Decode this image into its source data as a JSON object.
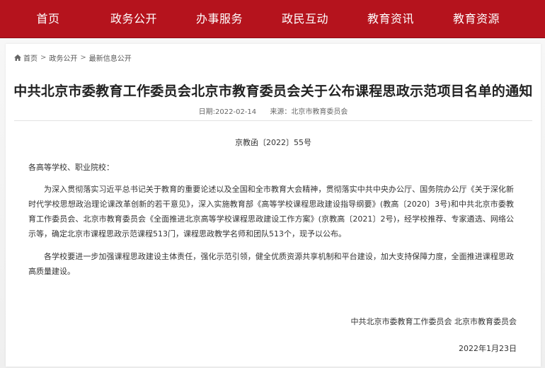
{
  "nav": {
    "items": [
      "首页",
      "政务公开",
      "办事服务",
      "政民互动",
      "教育资讯",
      "教育资源"
    ]
  },
  "breadcrumb": {
    "home": "首页",
    "level1": "政务公开",
    "level2": "最新信息公开",
    "separator": ">"
  },
  "article": {
    "title": "中共北京市委教育工作委员会北京市教育委员会关于公布课程思政示范项目名单的通知",
    "date": "日期:2022-02-14",
    "source": "来源：北京市教育委员会",
    "doc_number": "京教函〔2022〕55号",
    "salutation": "各高等学校、职业院校：",
    "paragraph1": "为深入贯彻落实习近平总书记关于教育的重要论述以及全国和全市教育大会精神，贯彻落实中共中央办公厅、国务院办公厅《关于深化新时代学校思想政治理论课改革创新的若干意见》，深入实施教育部《高等学校课程思政建设指导纲要》(教高〔2020〕3号)和中共北京市委教育工作委员会、北京市教育委员会《全面推进北京高等学校课程思政建设工作方案》(京教高〔2021〕2号)，经学校推荐、专家遴选、网络公示等，确定北京市课程思政示范课程513门，课程思政教学名师和团队513个，现予以公布。",
    "paragraph2": "各学校要进一步加强课程思政建设主体责任，强化示范引领，健全优质资源共享机制和平台建设，加大支持保障力度，全面推进课程思政高质量建设。",
    "signature": "中共北京市委教育工作委员会 北京市教育委员会",
    "sign_date": "2022年1月23日"
  },
  "colors": {
    "nav_bg": "#b5131d",
    "nav_text": "#ffffff"
  }
}
